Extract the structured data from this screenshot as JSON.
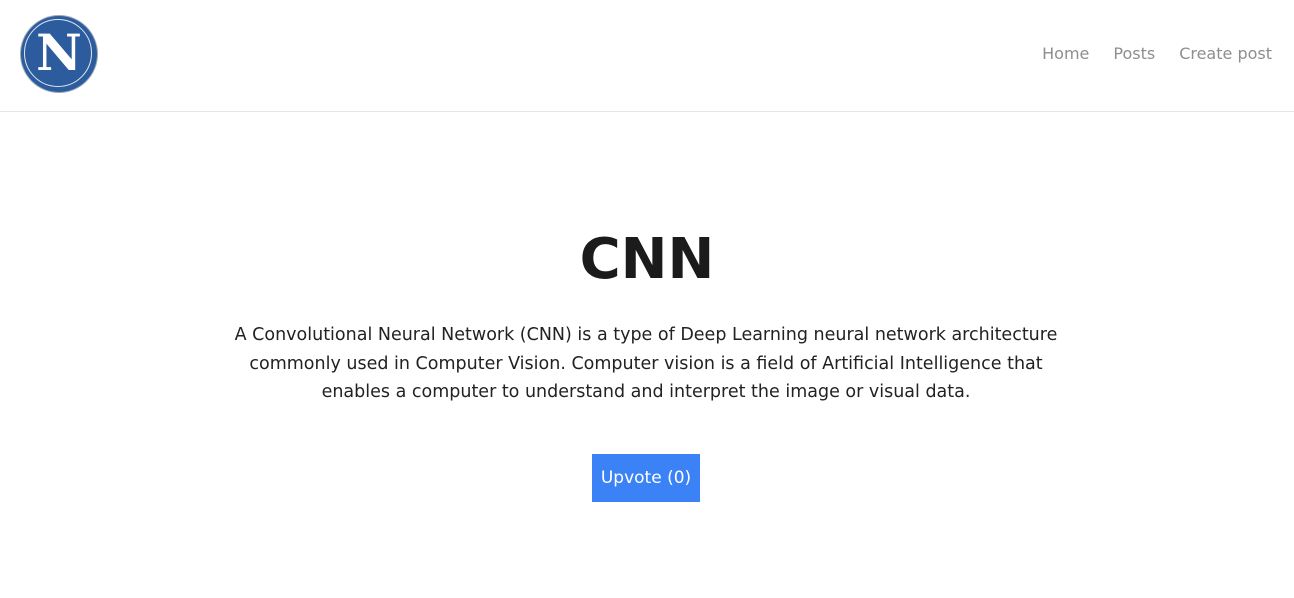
{
  "brand": {
    "logo_letter": "N",
    "logo_color": "#2d5c9e"
  },
  "nav": {
    "items": [
      {
        "label": "Home"
      },
      {
        "label": "Posts"
      },
      {
        "label": "Create post"
      }
    ]
  },
  "post": {
    "title": "CNN",
    "body": "A Convolutional Neural Network (CNN) is a type of Deep Learning neural network architecture commonly used in Computer Vision. Computer vision is a field of Artificial Intelligence that enables a computer to understand and interpret the image or visual data.",
    "upvote_label": "Upvote (0)",
    "button_color": "#3b82f6"
  }
}
